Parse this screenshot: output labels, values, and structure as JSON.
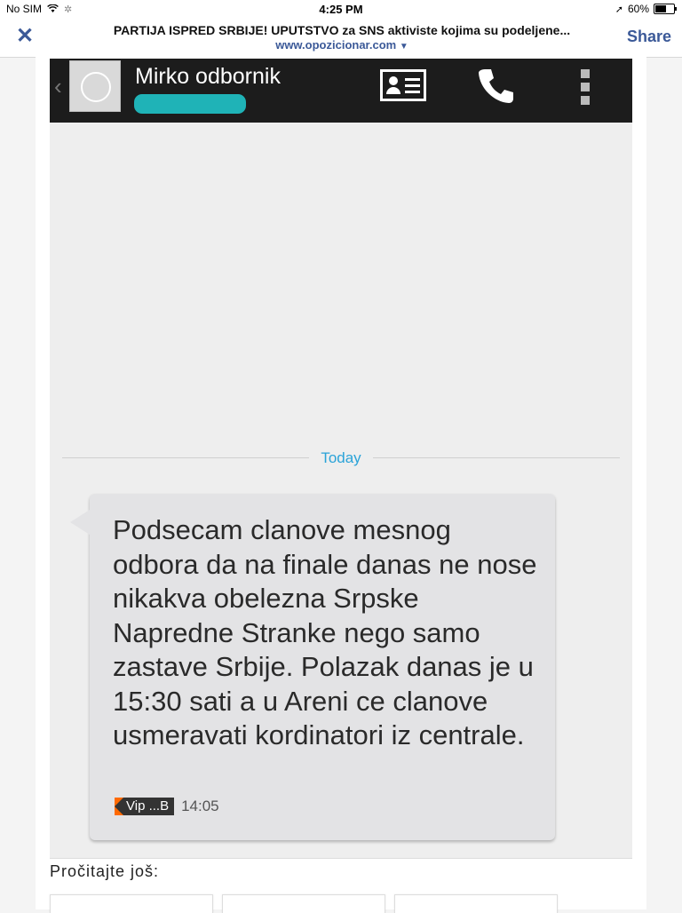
{
  "status_bar": {
    "carrier": "No SIM",
    "time": "4:25 PM",
    "battery": "60%",
    "battery_level": 0.6
  },
  "browser": {
    "title": "PARTIJA ISPRED SRBIJE! UPUTSTVO za SNS aktiviste kojima su podeljene...",
    "domain": "www.opozicionar.com",
    "share_label": "Share",
    "close_label": "✕"
  },
  "conversation": {
    "contact_name": "Mirko odbornik",
    "date_divider": "Today",
    "message": {
      "text": "Podsecam clanove mesnog odbora da na finale danas ne nose nikakva obelezna Srpske Napredne Stranke nego samo zastave Srbije. Polazak danas je u 15:30 sati a u Areni ce clanove usmeravati kordinatori iz centrale.",
      "sim_label": "Vip ...B",
      "time": "14:05"
    }
  },
  "footer": {
    "read_more_label": "Pročitajte još:"
  },
  "colors": {
    "brand": "#3b5998",
    "appbar": "#1c1c1c",
    "today": "#2aa3d8",
    "redaction": "#1fb3b7",
    "sim_accent": "#ff6a00"
  }
}
